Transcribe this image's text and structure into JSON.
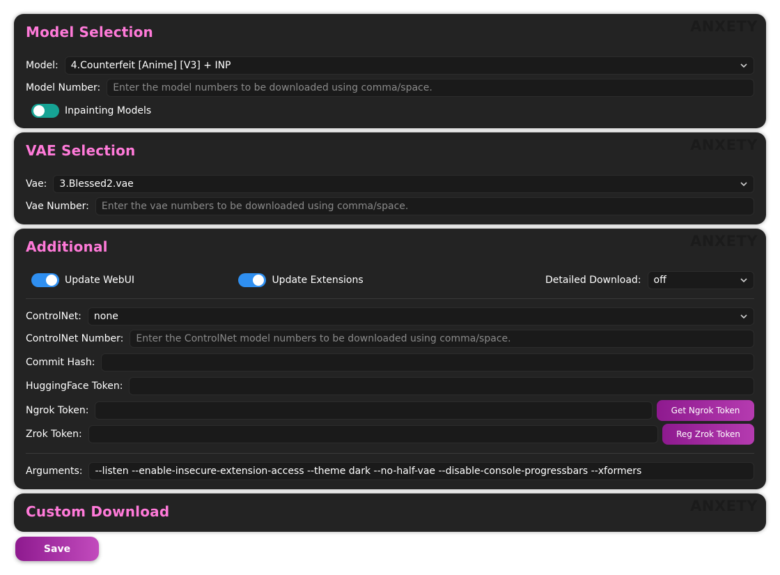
{
  "colors": {
    "accent": "#ff7ad9",
    "toggle_teal": "#16a394",
    "toggle_blue": "#2f8ff0",
    "button_gradient_start": "#8e1a8f",
    "button_gradient_end": "#c24bbd",
    "panel_bg": "#232323"
  },
  "watermark": "ANXETY",
  "model_selection": {
    "title": "Model Selection",
    "model_label": "Model:",
    "model_value": "4.Counterfeit [Anime] [V3] + INP",
    "model_number_label": "Model Number:",
    "model_number_placeholder": "Enter the model numbers to be downloaded using comma/space.",
    "inpainting_label": "Inpainting Models",
    "inpainting_on": true
  },
  "vae_selection": {
    "title": "VAE Selection",
    "vae_label": "Vae:",
    "vae_value": "3.Blessed2.vae",
    "vae_number_label": "Vae Number:",
    "vae_number_placeholder": "Enter the vae numbers to be downloaded using comma/space."
  },
  "additional": {
    "title": "Additional",
    "update_webui_label": "Update WebUI",
    "update_webui_on": true,
    "update_extensions_label": "Update Extensions",
    "update_extensions_on": true,
    "detailed_download_label": "Detailed Download:",
    "detailed_download_value": "off",
    "controlnet_label": "ControlNet:",
    "controlnet_value": "none",
    "controlnet_number_label": "ControlNet Number:",
    "controlnet_number_placeholder": "Enter the ControlNet model numbers to be downloaded using comma/space.",
    "commit_hash_label": "Commit Hash:",
    "commit_hash_value": "",
    "hf_token_label": "HuggingFace Token:",
    "hf_token_value": "",
    "ngrok_label": "Ngrok Token:",
    "ngrok_value": "",
    "ngrok_button": "Get Ngrok Token",
    "zrok_label": "Zrok Token:",
    "zrok_value": "",
    "zrok_button": "Reg Zrok Token",
    "arguments_label": "Arguments:",
    "arguments_value": "--listen --enable-insecure-extension-access --theme dark --no-half-vae --disable-console-progressbars --xformers"
  },
  "custom_download": {
    "title": "Custom Download"
  },
  "save_label": "Save"
}
